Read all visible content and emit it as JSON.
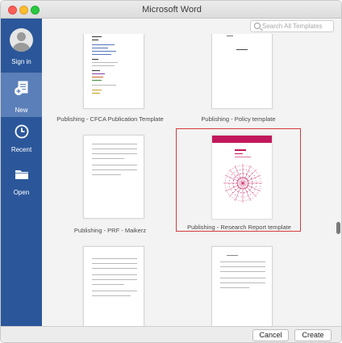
{
  "window": {
    "title": "Microsoft Word"
  },
  "search": {
    "placeholder": "Search All Templates"
  },
  "sidebar": {
    "items": [
      {
        "label": "Sign in",
        "icon": "avatar-icon"
      },
      {
        "label": "New",
        "icon": "new-document-icon",
        "active": true
      },
      {
        "label": "Recent",
        "icon": "clock-icon"
      },
      {
        "label": "Open",
        "icon": "folder-icon"
      }
    ]
  },
  "templates": [
    {
      "label": "Publishing - CFCA Publication Template"
    },
    {
      "label": "Publishing - Policy template"
    },
    {
      "label": "Publishing - PRF - Maikerz"
    },
    {
      "label": "Publishing - Research Report template",
      "selected": true
    },
    {
      "label": ""
    },
    {
      "label": ""
    }
  ],
  "footer": {
    "cancel_label": "Cancel",
    "create_label": "Create"
  },
  "colors": {
    "sidebar": "#2b579a",
    "sidebar_active": "#5b7fb8",
    "selection": "#d63b3b",
    "report_cover": "#c2185b"
  }
}
